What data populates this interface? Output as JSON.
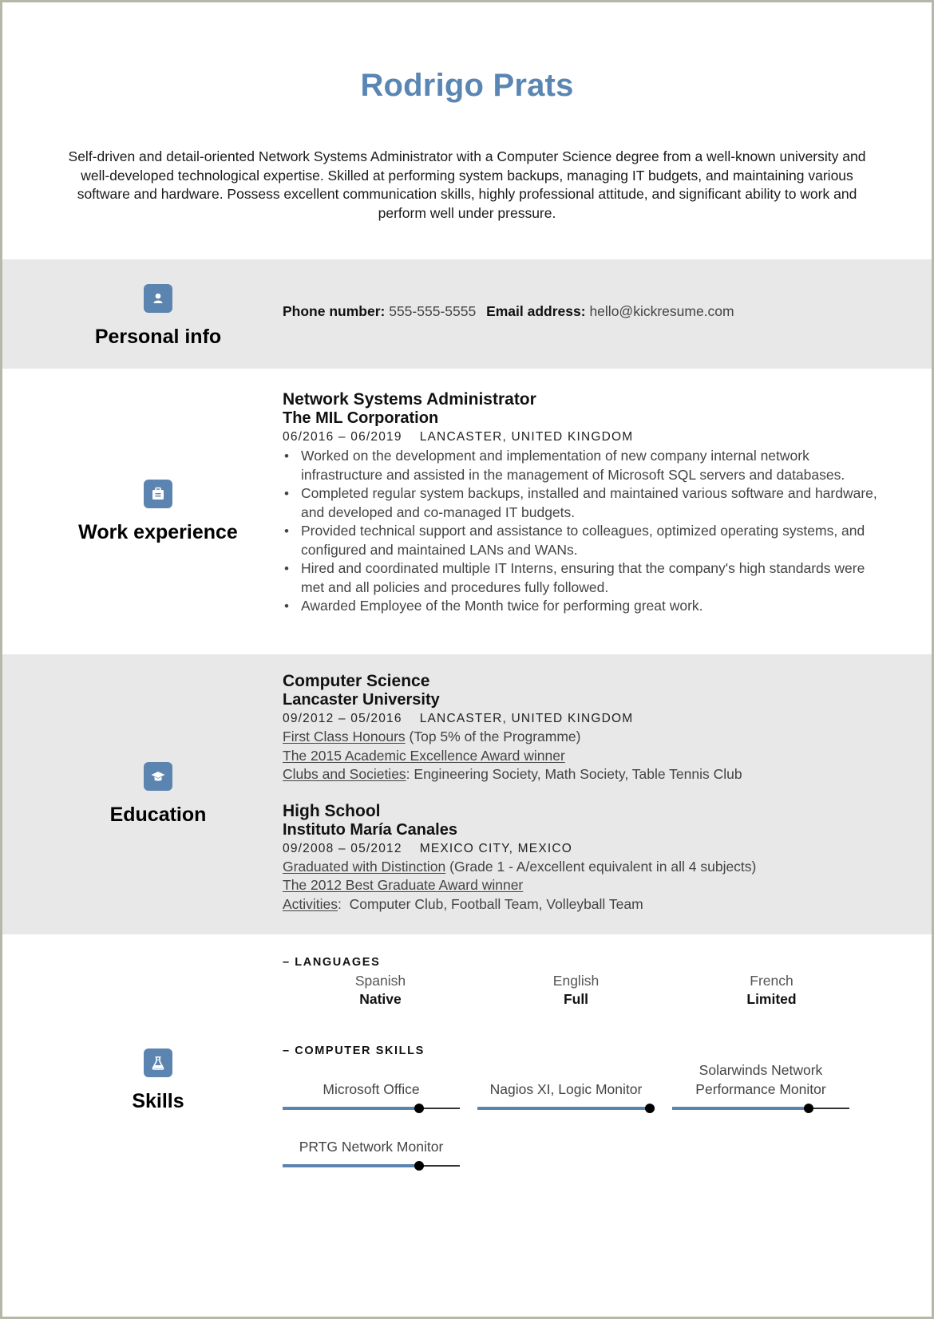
{
  "header": {
    "name": "Rodrigo Prats",
    "summary": "Self-driven and detail-oriented Network Systems Administrator with a Computer Science degree from a well-known university and well-developed technological expertise. Skilled at performing system backups, managing IT budgets, and maintaining various software and hardware. Possess excellent communication skills, highly professional attitude, and significant ability to work and perform well under pressure."
  },
  "colors": {
    "accent": "#5b84b1",
    "name": "#5a86b3",
    "section_grey": "#e8e8e8"
  },
  "personal_info": {
    "title": "Personal info",
    "icon": "user-icon",
    "phone_label": "Phone number:",
    "phone": "555-555-5555",
    "email_label": "Email address:",
    "email": "hello@kickresume.com"
  },
  "work_experience": {
    "title": "Work experience",
    "icon": "briefcase-icon",
    "jobs": [
      {
        "title": "Network Systems Administrator",
        "company": "The MIL Corporation",
        "dates": "06/2016 – 06/2019",
        "location": "LANCASTER, UNITED KINGDOM",
        "bullets": [
          "Worked on the development and implementation of new company internal network infrastructure and assisted in the management of Microsoft SQL servers and databases.",
          "Completed regular system backups, installed and maintained various software and hardware, and developed and co-managed IT budgets.",
          "Provided technical support and assistance to colleagues, optimized operating systems, and configured and maintained LANs and WANs.",
          "Hired and coordinated multiple IT Interns, ensuring that the company's high standards were met and all policies and procedures fully followed.",
          "Awarded Employee of the Month twice for performing great work."
        ]
      }
    ]
  },
  "education": {
    "title": "Education",
    "icon": "graduation-cap-icon",
    "entries": [
      {
        "degree": "Computer Science",
        "school": "Lancaster University",
        "dates": "09/2012 – 05/2016",
        "location": "LANCASTER, UNITED KINGDOM",
        "lines": [
          {
            "underlined": "First Class Honours",
            "rest": " (Top 5% of the Programme)"
          },
          {
            "underlined": "The 2015 Academic Excellence Award winner",
            "rest": ""
          },
          {
            "underlined": "Clubs and Societies",
            "rest": ": Engineering Society, Math Society, Table Tennis Club"
          }
        ]
      },
      {
        "degree": "High School",
        "school": "Instituto María Canales",
        "dates": "09/2008 – 05/2012",
        "location": "MEXICO CITY, MEXICO",
        "lines": [
          {
            "underlined": "Graduated with Distinction",
            "rest": " (Grade 1 - A/excellent equivalent in all 4 subjects)"
          },
          {
            "underlined": "The 2012 Best Graduate Award winner",
            "rest": ""
          },
          {
            "underlined": "Activities",
            "rest": ":  Computer Club, Football Team, Volleyball Team"
          }
        ]
      }
    ]
  },
  "skills": {
    "title": "Skills",
    "icon": "flask-icon",
    "languages_heading": "– LANGUAGES",
    "languages": [
      {
        "name": "Spanish",
        "level": "Native"
      },
      {
        "name": "English",
        "level": "Full"
      },
      {
        "name": "French",
        "level": "Limited"
      }
    ],
    "computer_heading": "– COMPUTER SKILLS",
    "computer_skills": [
      {
        "name": "Microsoft Office",
        "level": 0.77
      },
      {
        "name": "Nagios XI, Logic Monitor",
        "level": 1.0
      },
      {
        "name": "Solarwinds Network Performance Monitor",
        "level": 0.77
      },
      {
        "name": "PRTG Network Monitor",
        "level": 0.77
      }
    ]
  }
}
